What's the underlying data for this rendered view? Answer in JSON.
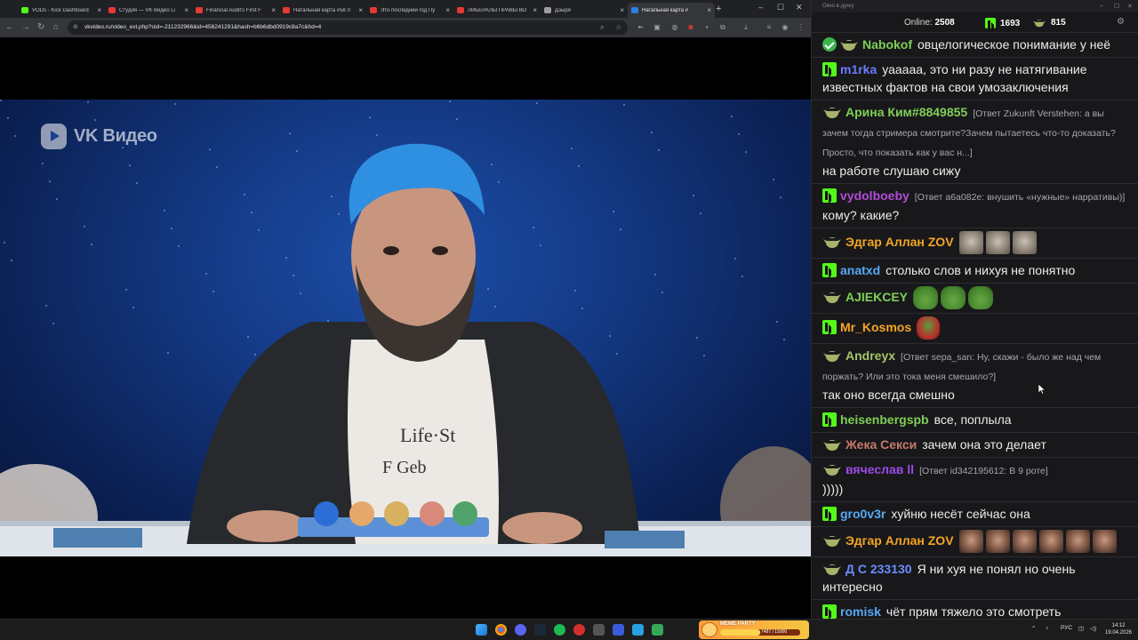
{
  "browser": {
    "tabs": [
      {
        "title": "VODs - Kick Dashboard",
        "favicon_color": "#53fc18",
        "active": false
      },
      {
        "title": "Студия — VK Видео Li",
        "favicon_color": "#e53935",
        "active": false
      },
      {
        "title": "Financial Audit's First F",
        "favicon_color": "#e53935",
        "active": false
      },
      {
        "title": "Натальная карта #58 Л",
        "favicon_color": "#e53935",
        "active": false
      },
      {
        "title": "Это последний год Пу",
        "favicon_color": "#e53935",
        "active": false
      },
      {
        "title": "ЛИБЕРАЛЫ ПРАВЫ ВО",
        "favicon_color": "#e53935",
        "active": false
      },
      {
        "title": "Дзыря",
        "favicon_color": "#9e9e9e",
        "active": false
      },
      {
        "title": "Натальная карта #",
        "favicon_color": "#2d81e0",
        "active": true
      }
    ],
    "url": "vkvideo.ru/video_ext.php?oid=-211232966&id=456241291&hash=b6b6dbd0919c8a7c&hd=4"
  },
  "video": {
    "watermark": "VK Видео"
  },
  "chat": {
    "window_title": "Окно в духку",
    "online_label": "Online:",
    "online_count": "2508",
    "kick_count": "1693",
    "other_count": "815",
    "messages": [
      {
        "badge": "check+goblin",
        "user": "Nabokof",
        "color": "#7fcf56",
        "text": "овцелогическое понимание у неё"
      },
      {
        "badge": "kick",
        "user": "m1rka",
        "color": "#6b7bff",
        "text": "уааааа, это ни разу не натягивание известных фактов на свои умозаключения"
      },
      {
        "badge": "goblin",
        "user": "Арина Ким#8849855",
        "color": "#7fcf56",
        "reply": "[Ответ Zukunft Verstehen: а вы зачем тогда стримера смотрите?Зачем пытаетесь что-то доказать? Просто, что показать как у вас н...]",
        "text": "на работе слушаю сижу"
      },
      {
        "badge": "kick",
        "user": "vydolboeby",
        "color": "#b24bd9",
        "reply": "[Ответ a6a082e: внушить «нужные» нарративы)]",
        "text": "кому? какие?"
      },
      {
        "badge": "goblin",
        "user": "Эдгар Аллан ZOV",
        "color": "#f5a623",
        "emotes": [
          "cat",
          "cat",
          "cat"
        ]
      },
      {
        "badge": "kick",
        "user": "anatxd",
        "color": "#56a9f5",
        "text": "столько слов и нихуя не понятно"
      },
      {
        "badge": "goblin",
        "user": "AJIEKCEY",
        "color": "#7fcf56",
        "emotes": [
          "pepe",
          "pepe",
          "pepe"
        ]
      },
      {
        "badge": "kick",
        "user": "Mr_Kosmos",
        "color": "#f5a623",
        "emotes": [
          "peper"
        ]
      },
      {
        "badge": "goblin",
        "user": "Andreyx",
        "color": "#a8c46a",
        "reply": "[Ответ sepa_san: Ну, скажи - было же над чем поржать? Или это тока меня смешило?]",
        "text": "так оно всегда смешно"
      },
      {
        "badge": "kick",
        "user": "heisenbergspb",
        "color": "#7fcf56",
        "text": "все, поплыла"
      },
      {
        "badge": "goblin",
        "user": "Жека Секси",
        "color": "#c7796a",
        "text": "зачем она это делает"
      },
      {
        "badge": "goblin",
        "user": "вячеслав ll",
        "color": "#9b4be6",
        "reply": "[Ответ id342195612: В 9 роте]",
        "text": ")))))"
      },
      {
        "badge": "kick",
        "user": "gro0v3r",
        "color": "#56a9f5",
        "text": "хуйню несёт сейчас она"
      },
      {
        "badge": "goblin",
        "user": "Эдгар Аллан ZOV",
        "color": "#f5a623",
        "emotes": [
          "face",
          "face",
          "face",
          "face",
          "face",
          "face"
        ]
      },
      {
        "badge": "goblin",
        "user": "Д С 233130",
        "color": "#6b8cff",
        "text": "Я ни хуя не понял но очень интересно"
      },
      {
        "badge": "kick",
        "user": "romisk",
        "color": "#56a9f5",
        "text": "чёт прям тяжело это смотреть"
      }
    ]
  },
  "taskbar": {
    "meme_title": "MEME PARTY",
    "meme_counter": "7487 / 15000",
    "meme_progress": 0.5,
    "lang": "РУС",
    "time": "14:12",
    "date": "19.04.2026"
  }
}
